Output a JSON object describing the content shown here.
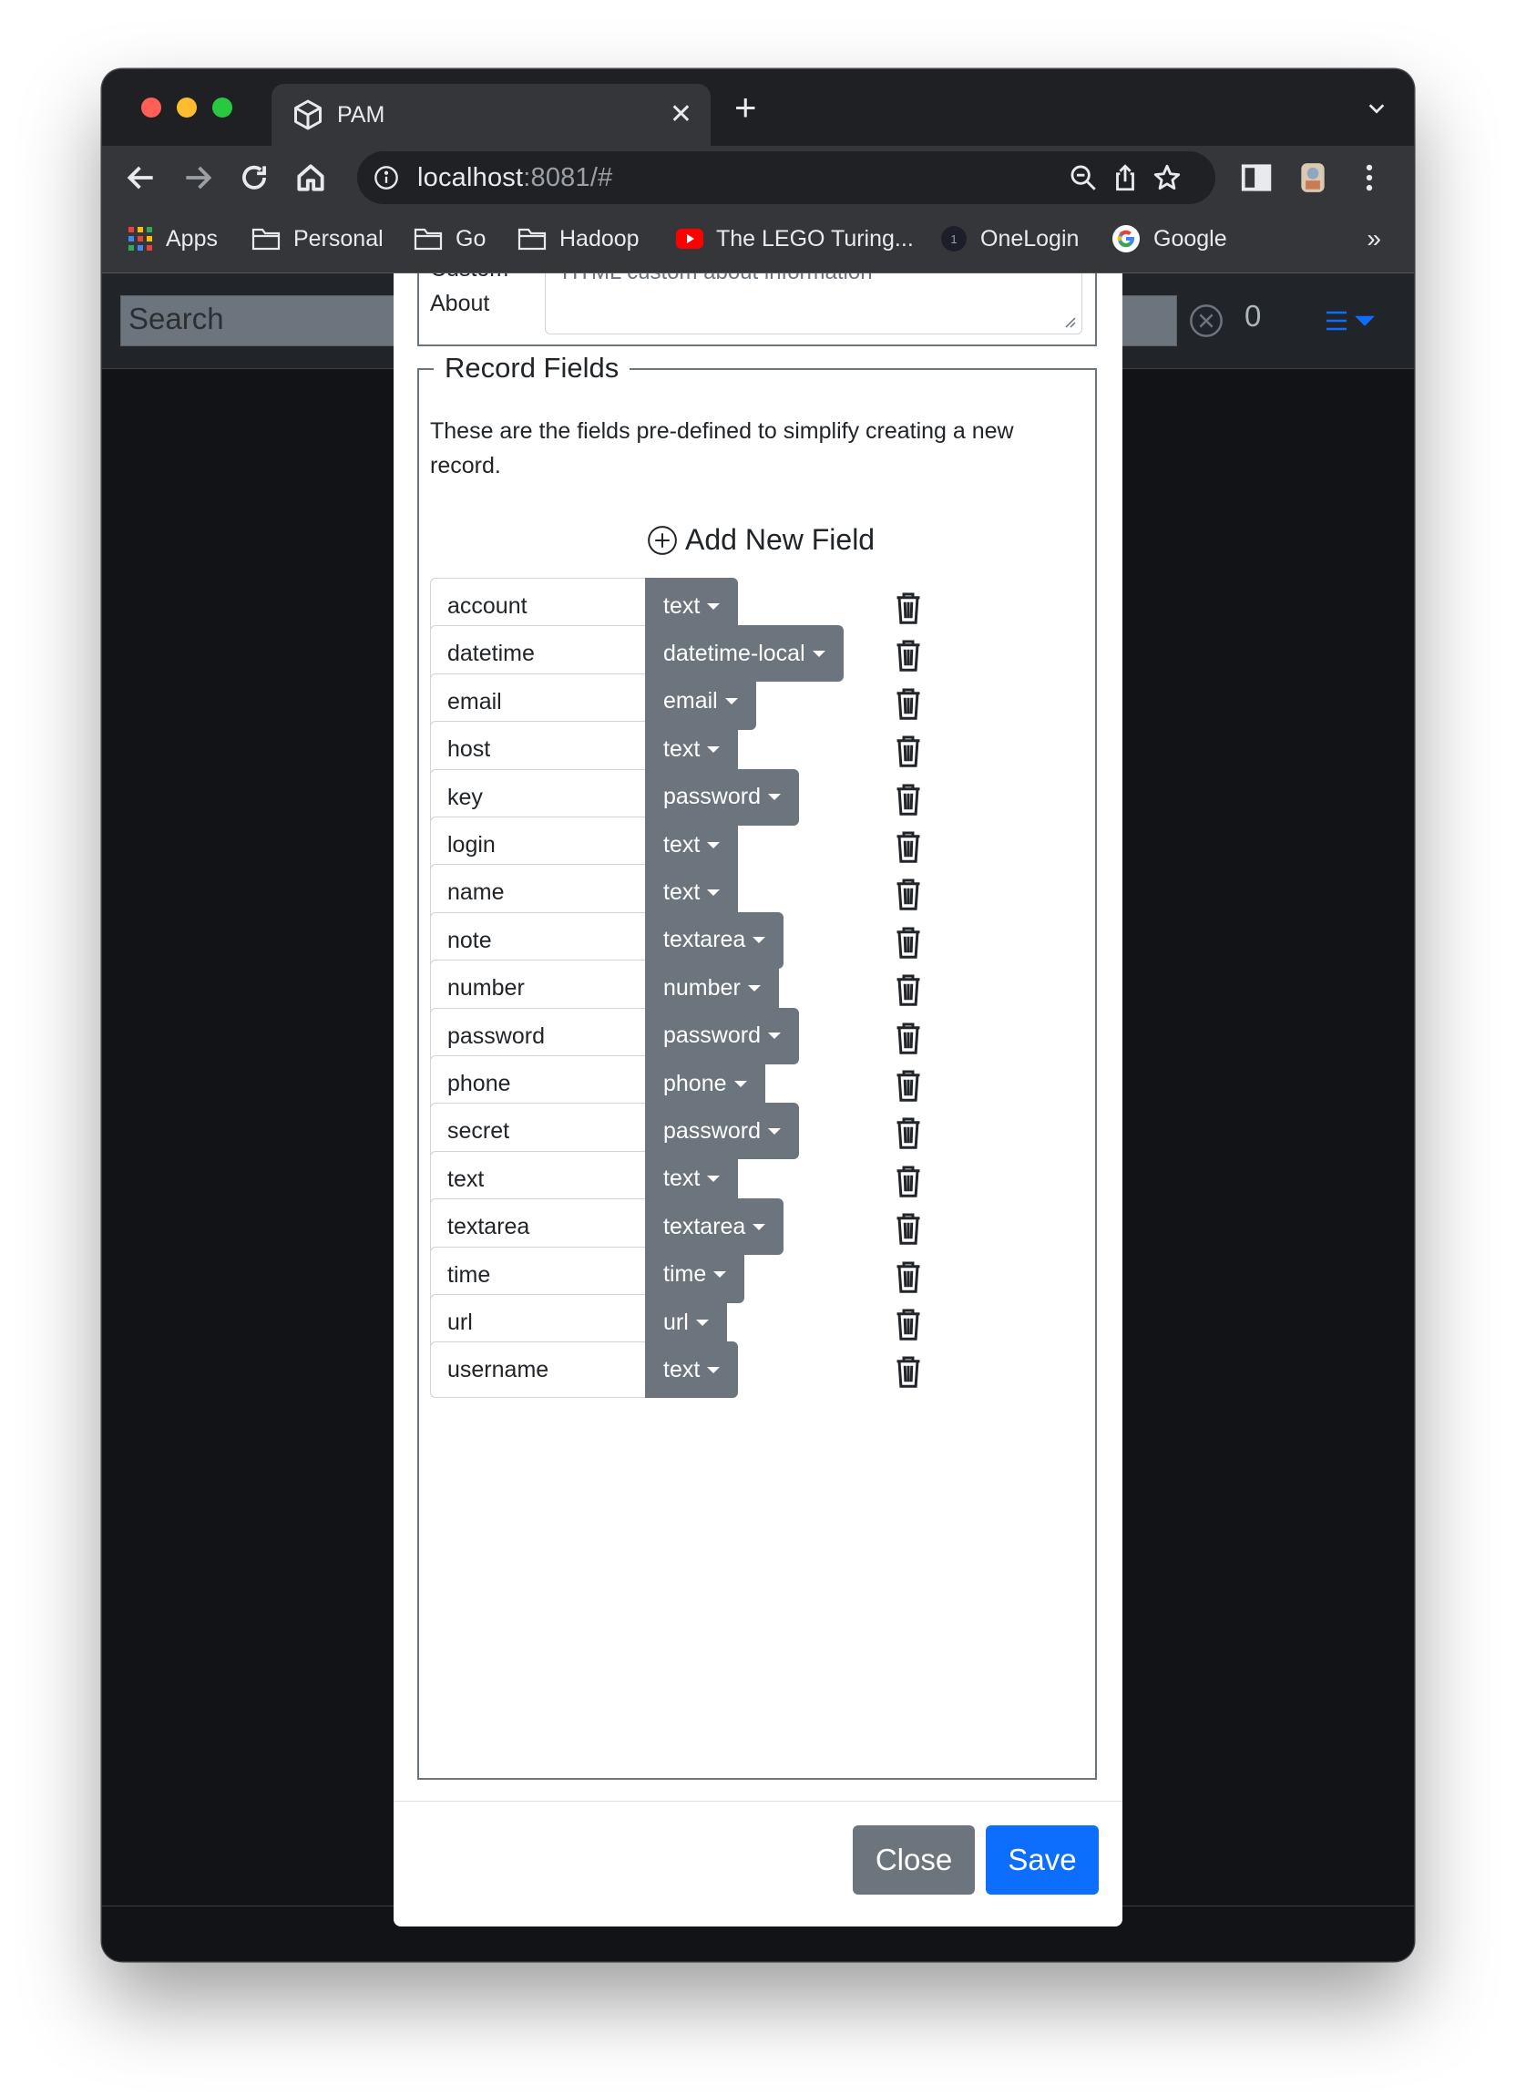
{
  "browser": {
    "tab_title": "PAM",
    "url_host": "localhost",
    "url_rest": ":8081/#",
    "bookmarks": [
      {
        "label": "Apps",
        "icon": "apps-grid-icon"
      },
      {
        "label": "Personal",
        "icon": "folder-icon"
      },
      {
        "label": "Go",
        "icon": "folder-icon"
      },
      {
        "label": "Hadoop",
        "icon": "folder-icon"
      },
      {
        "label": "The LEGO Turing...",
        "icon": "youtube-icon"
      },
      {
        "label": "OneLogin",
        "icon": "onelogin-icon"
      },
      {
        "label": "Google",
        "icon": "google-icon"
      }
    ],
    "more_bookmarks": "»"
  },
  "header": {
    "search_placeholder": "Search",
    "count": "0"
  },
  "modal": {
    "custom_about_label": "Custom About",
    "about_placeholder": "HTML custom about information",
    "record_fields": {
      "legend": "Record Fields",
      "description": "These are the fields pre-defined to simplify creating a new record.",
      "add_label": "Add New Field",
      "fields": [
        {
          "name": "account",
          "type": "text"
        },
        {
          "name": "datetime",
          "type": "datetime-local"
        },
        {
          "name": "email",
          "type": "email"
        },
        {
          "name": "host",
          "type": "text"
        },
        {
          "name": "key",
          "type": "password"
        },
        {
          "name": "login",
          "type": "text"
        },
        {
          "name": "name",
          "type": "text"
        },
        {
          "name": "note",
          "type": "textarea"
        },
        {
          "name": "number",
          "type": "number"
        },
        {
          "name": "password",
          "type": "password"
        },
        {
          "name": "phone",
          "type": "phone"
        },
        {
          "name": "secret",
          "type": "password"
        },
        {
          "name": "text",
          "type": "text"
        },
        {
          "name": "textarea",
          "type": "textarea"
        },
        {
          "name": "time",
          "type": "time"
        },
        {
          "name": "url",
          "type": "url"
        },
        {
          "name": "username",
          "type": "text"
        }
      ]
    },
    "buttons": {
      "close": "Close",
      "save": "Save"
    }
  },
  "colors": {
    "primary": "#0d6efd",
    "secondary": "#6c757d",
    "menu_accent": "#0d6efd"
  }
}
